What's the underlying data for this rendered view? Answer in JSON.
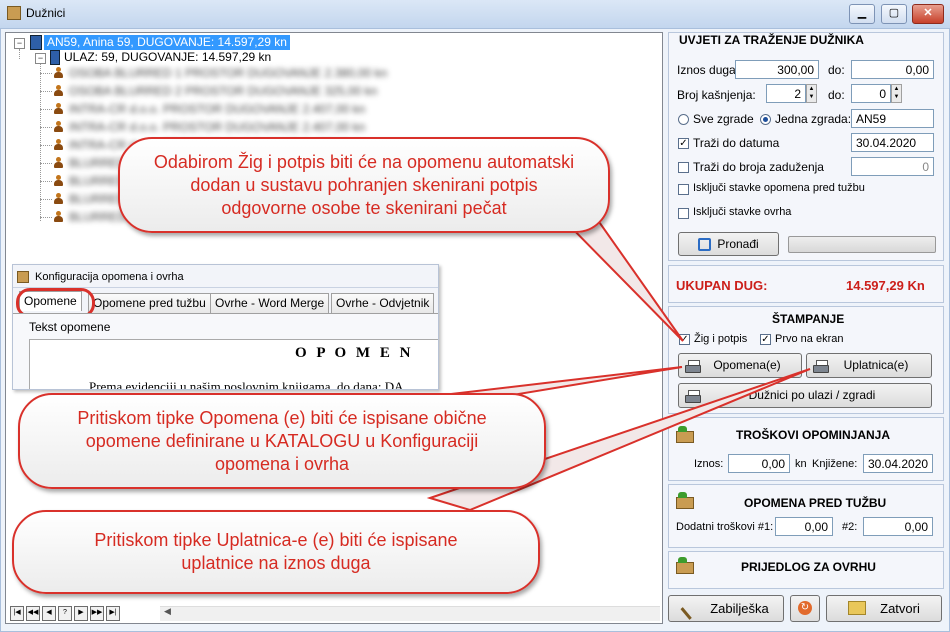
{
  "window": {
    "title": "Dužnici",
    "minimize_icon": "minimize-icon",
    "maximize_icon": "maximize-icon",
    "close_icon": "close-icon"
  },
  "tree": {
    "root": "AN59, Anina 59, DUGOVANJE: 14.597,29 kn",
    "child": "ULAZ: 59, DUGOVANJE: 14.597,29 kn",
    "leaves": [
      "OSOBA BLURRED 1 PROSTOR DUGOVANJE 2.380,00 kn",
      "OSOBA BLURRED 2 PROSTOR DUGOVANJE 325,00 kn",
      "INTRA-CR d.o.o. PROSTOR DUGOVANJE 2.407,00 kn",
      "INTRA-CR d.o.o. PROSTOR DUGOVANJE 2.407,00 kn",
      "INTRA-CR d.o.o. PROSTOR DUGOVANJE 2.407,00 kn",
      "BLURRED PROSTOR DUGOVANJE",
      "BLURRED PROSTOR DUGOVANJE",
      "BLURRED PROSTOR DUGOVANJE",
      "BLURRED PROSTOR DUGOVANJE"
    ]
  },
  "embedded": {
    "title": "Konfiguracija opomena i ovrha",
    "tabs": [
      "Opomene",
      "Opomene pred tužbu",
      "Ovrhe - Word Merge",
      "Ovrhe - Odvjetnik"
    ],
    "section_label": "Tekst opomene",
    "heading": "O P O M E N",
    "body_line": "Prema evidenciji u našim poslovnim knjigama, do dana: DA"
  },
  "nav": {
    "buttons": [
      "|◀",
      "◀◀",
      "◀",
      "?",
      "▶",
      "▶▶",
      "▶|"
    ]
  },
  "criteria": {
    "title": "UVJETI ZA TRAŽENJE DUŽNIKA",
    "iznos_label": "Iznos duga:",
    "iznos_from": "300,00",
    "do_label": "do:",
    "iznos_to": "0,00",
    "kasnjenja_label": "Broj kašnjenja:",
    "kasnjenja_from": "2",
    "kasnjenja_to": "0",
    "radio_all": "Sve zgrade",
    "radio_one": "Jedna zgrada:",
    "zgrada_value": "AN59",
    "date_label": "Traži do datuma",
    "date_value": "30.04.2020",
    "date_checked": true,
    "zaduzenja_label": "Traži do broja zaduženja",
    "zaduzenja_value": "0",
    "excl_tuzba_label": "Isključi stavke opomena pred tužbu",
    "excl_ovrha_label": "Isključi stavke ovrha",
    "search_label": "Pronađi"
  },
  "summary": {
    "label": "UKUPAN DUG:",
    "value": "14.597,29 Kn",
    "accent": "#cc1f1a"
  },
  "print": {
    "title": "ŠTAMPANJE",
    "zig_label": "Žig i potpis",
    "ekran_label": "Prvo na ekran",
    "opomena_label": "Opomena(e)",
    "uplatnica_label": "Uplatnica(e)",
    "duznici_label": "Dužnici po ulazi / zgradi"
  },
  "troskovi": {
    "title": "TROŠKOVI OPOMINJANJA",
    "iznos_label": "Iznos:",
    "iznos_value": "0,00",
    "kn_label": "kn",
    "knjizenje_label": "Knjižene:",
    "knjizenje_value": "30.04.2020"
  },
  "pred_tuzbu": {
    "title": "OPOMENA PRED TUŽBU",
    "label1": "Dodatni troškovi #1:",
    "value1": "0,00",
    "label2": "#2:",
    "value2": "0,00"
  },
  "ovrha": {
    "title": "PRIJEDLOG ZA OVRHU"
  },
  "bottom": {
    "zabiljeska_label": "Zabilješka",
    "zatvori_label": "Zatvori"
  },
  "callouts": {
    "top": "Odabirom Žig i potpis biti će na opomenu automatski dodan u sustavu pohranjen skenirani potpis odgovorne osobe te skenirani pečat",
    "middle": "Pritiskom tipke Opomena (e) biti će ispisane obične opomene definirane u KATALOGU u Konfiguraciji opomena i ovrha",
    "bottom": "Pritiskom tipke Uplatnica-e (e) biti će ispisane uplatnice na iznos duga"
  }
}
